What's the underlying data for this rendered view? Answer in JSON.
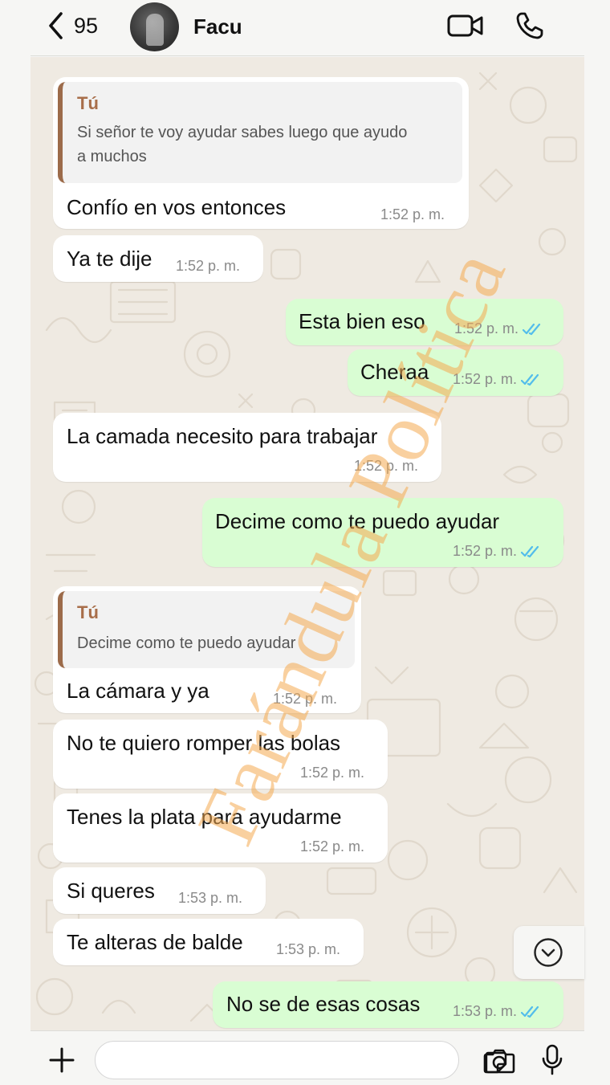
{
  "header": {
    "back_count": "95",
    "contact_name": "Facu"
  },
  "messages": [
    {
      "id": "m1",
      "direction": "incoming",
      "quote_author": "Tú",
      "quote_text_line1": "Si señor te voy ayudar sabes luego que ayudo",
      "quote_text_line2": "a muchos",
      "text": "Confío en vos entonces",
      "time": "1:52 p. m."
    },
    {
      "id": "m2",
      "direction": "incoming",
      "text": "Ya te dije",
      "time": "1:52 p. m."
    },
    {
      "id": "m3",
      "direction": "outgoing",
      "text": "Esta bien eso",
      "time": "1:52 p. m.",
      "status": "read"
    },
    {
      "id": "m4",
      "direction": "outgoing",
      "text": "Cheraa",
      "time": "1:52 p. m.",
      "status": "read"
    },
    {
      "id": "m5",
      "direction": "incoming",
      "text": "La camada necesito para trabajar",
      "time": "1:52 p. m."
    },
    {
      "id": "m6",
      "direction": "outgoing",
      "text": "Decime como te puedo ayudar",
      "time": "1:52 p. m.",
      "status": "read"
    },
    {
      "id": "m7",
      "direction": "incoming",
      "quote_author": "Tú",
      "quote_text_line1": "Decime como te puedo ayudar",
      "text": "La cámara y ya",
      "time": "1:52 p. m."
    },
    {
      "id": "m8",
      "direction": "incoming",
      "text": "No te quiero romper las bolas",
      "time": "1:52 p. m."
    },
    {
      "id": "m9",
      "direction": "incoming",
      "text": "Tenes la plata para ayudarme",
      "time": "1:52 p. m."
    },
    {
      "id": "m10",
      "direction": "incoming",
      "text": "Si queres",
      "time": "1:53 p. m."
    },
    {
      "id": "m11",
      "direction": "incoming",
      "text": "Te alteras de balde",
      "time": "1:53 p. m."
    },
    {
      "id": "m12",
      "direction": "outgoing",
      "text": "No se de esas cosas",
      "time": "1:53 p. m.",
      "status": "read"
    }
  ],
  "watermark": "Farándula Política",
  "composer": {
    "placeholder": ""
  },
  "colors": {
    "incoming_bubble": "#ffffff",
    "outgoing_bubble": "#d9fdd3",
    "read_ticks": "#53bdeb",
    "quote_accent": "#9c6b4a"
  }
}
